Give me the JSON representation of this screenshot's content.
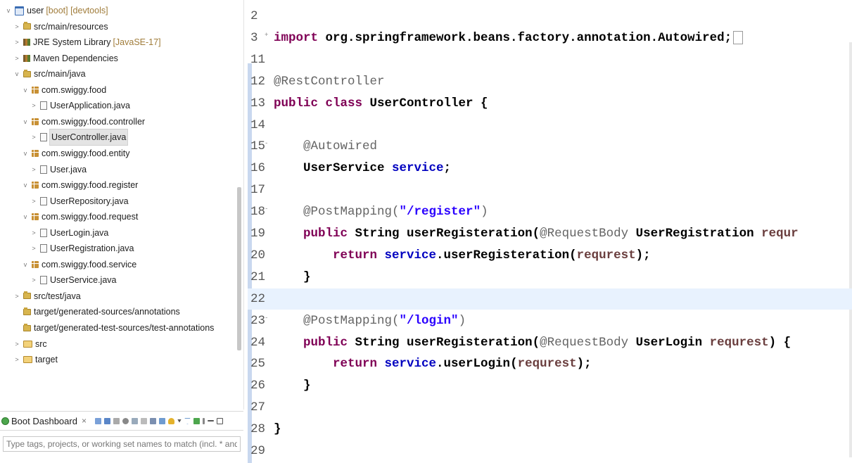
{
  "explorer": {
    "items": [
      {
        "twisty": "v",
        "icon": "project",
        "label": "user",
        "deco": "[boot] [devtools]"
      },
      {
        "twisty": ">",
        "icon": "srcfolder",
        "label": "src/main/resources"
      },
      {
        "twisty": ">",
        "icon": "library",
        "label": "JRE System Library",
        "deco": "[JavaSE-17]"
      },
      {
        "twisty": ">",
        "icon": "library",
        "label": "Maven Dependencies"
      },
      {
        "twisty": "v",
        "icon": "srcfolder",
        "label": "src/main/java"
      },
      {
        "twisty": "v",
        "icon": "package",
        "label": "com.swiggy.food"
      },
      {
        "twisty": ">",
        "icon": "java",
        "label": "UserApplication.java"
      },
      {
        "twisty": "v",
        "icon": "package",
        "label": "com.swiggy.food.controller"
      },
      {
        "twisty": ">",
        "icon": "java",
        "label": "UserController.java"
      },
      {
        "twisty": "v",
        "icon": "package",
        "label": "com.swiggy.food.entity"
      },
      {
        "twisty": ">",
        "icon": "java",
        "label": "User.java"
      },
      {
        "twisty": "v",
        "icon": "package",
        "label": "com.swiggy.food.register"
      },
      {
        "twisty": ">",
        "icon": "java",
        "label": "UserRepository.java"
      },
      {
        "twisty": "v",
        "icon": "package",
        "label": "com.swiggy.food.request"
      },
      {
        "twisty": ">",
        "icon": "java",
        "label": "UserLogin.java"
      },
      {
        "twisty": ">",
        "icon": "java",
        "label": "UserRegistration.java"
      },
      {
        "twisty": "v",
        "icon": "package",
        "label": "com.swiggy.food.service"
      },
      {
        "twisty": ">",
        "icon": "java",
        "label": "UserService.java"
      },
      {
        "twisty": ">",
        "icon": "srcfolder",
        "label": "src/test/java"
      },
      {
        "twisty": "",
        "icon": "srcfolder",
        "label": "target/generated-sources/annotations"
      },
      {
        "twisty": "",
        "icon": "srcfolder",
        "label": "target/generated-test-sources/test-annotations"
      },
      {
        "twisty": ">",
        "icon": "folder",
        "label": "src"
      },
      {
        "twisty": ">",
        "icon": "folder",
        "label": "target"
      }
    ],
    "selected_label": "UserController.java"
  },
  "boot_dashboard": {
    "tab_label": "Boot Dashboard",
    "close_glyph": "×",
    "filter_placeholder": "Type tags, projects, or working set names to match (incl. * and ? w"
  },
  "editor": {
    "lines": [
      {
        "n": "2",
        "tokens": []
      },
      {
        "n": "3",
        "fold": "+",
        "tokens": [
          [
            "kw",
            "import "
          ],
          [
            "plain",
            "org.springframework.beans.factory.annotation.Autowired;"
          ]
        ],
        "collapsed": true
      },
      {
        "n": "11",
        "tokens": []
      },
      {
        "n": "12",
        "tokens": [
          [
            "ann",
            "@RestController"
          ]
        ]
      },
      {
        "n": "13",
        "tokens": [
          [
            "kw",
            "public class "
          ],
          [
            "cls",
            "UserController {"
          ]
        ]
      },
      {
        "n": "14",
        "tokens": []
      },
      {
        "n": "15",
        "fold": "-",
        "tokens": [
          [
            "plain",
            "    "
          ],
          [
            "ann",
            "@Autowired"
          ]
        ]
      },
      {
        "n": "16",
        "tokens": [
          [
            "plain",
            "    UserService "
          ],
          [
            "field",
            "service"
          ],
          [
            "plain",
            ";"
          ]
        ]
      },
      {
        "n": "17",
        "tokens": []
      },
      {
        "n": "18",
        "fold": "-",
        "tokens": [
          [
            "plain",
            "    "
          ],
          [
            "ann",
            "@PostMapping("
          ],
          [
            "str",
            "\"/register\""
          ],
          [
            "ann",
            ")"
          ]
        ]
      },
      {
        "n": "19",
        "tokens": [
          [
            "plain",
            "    "
          ],
          [
            "kw",
            "public "
          ],
          [
            "plain",
            "String userRegisteration("
          ],
          [
            "ann",
            "@RequestBody "
          ],
          [
            "plain",
            "UserRegistration "
          ],
          [
            "param",
            "requr"
          ]
        ]
      },
      {
        "n": "20",
        "tokens": [
          [
            "plain",
            "        "
          ],
          [
            "kw",
            "return "
          ],
          [
            "field",
            "service"
          ],
          [
            "plain",
            ".userRegisteration("
          ],
          [
            "param",
            "requrest"
          ],
          [
            "plain",
            ");"
          ]
        ]
      },
      {
        "n": "21",
        "tokens": [
          [
            "plain",
            "    }"
          ]
        ]
      },
      {
        "n": "22",
        "tokens": [],
        "current": true
      },
      {
        "n": "23",
        "fold": "-",
        "tokens": [
          [
            "plain",
            "    "
          ],
          [
            "ann",
            "@PostMapping("
          ],
          [
            "str",
            "\"/login\""
          ],
          [
            "ann",
            ")"
          ]
        ]
      },
      {
        "n": "24",
        "tokens": [
          [
            "plain",
            "    "
          ],
          [
            "kw",
            "public "
          ],
          [
            "plain",
            "String userRegisteration("
          ],
          [
            "ann",
            "@RequestBody "
          ],
          [
            "plain",
            "UserLogin "
          ],
          [
            "param",
            "requrest"
          ],
          [
            "plain",
            ") {"
          ]
        ]
      },
      {
        "n": "25",
        "tokens": [
          [
            "plain",
            "        "
          ],
          [
            "kw",
            "return "
          ],
          [
            "field",
            "service"
          ],
          [
            "plain",
            ".userLogin("
          ],
          [
            "param",
            "requrest"
          ],
          [
            "plain",
            ");"
          ]
        ]
      },
      {
        "n": "26",
        "tokens": [
          [
            "plain",
            "    }"
          ]
        ]
      },
      {
        "n": "27",
        "tokens": []
      },
      {
        "n": "28",
        "tokens": [
          [
            "plain",
            "}"
          ]
        ]
      },
      {
        "n": "29",
        "tokens": []
      }
    ]
  },
  "colors": {
    "keyword": "#7f0055",
    "annotation": "#646464",
    "string": "#2a00ff",
    "field": "#0000c0",
    "param": "#6a3e3e",
    "current_line": "#e8f2fe"
  }
}
